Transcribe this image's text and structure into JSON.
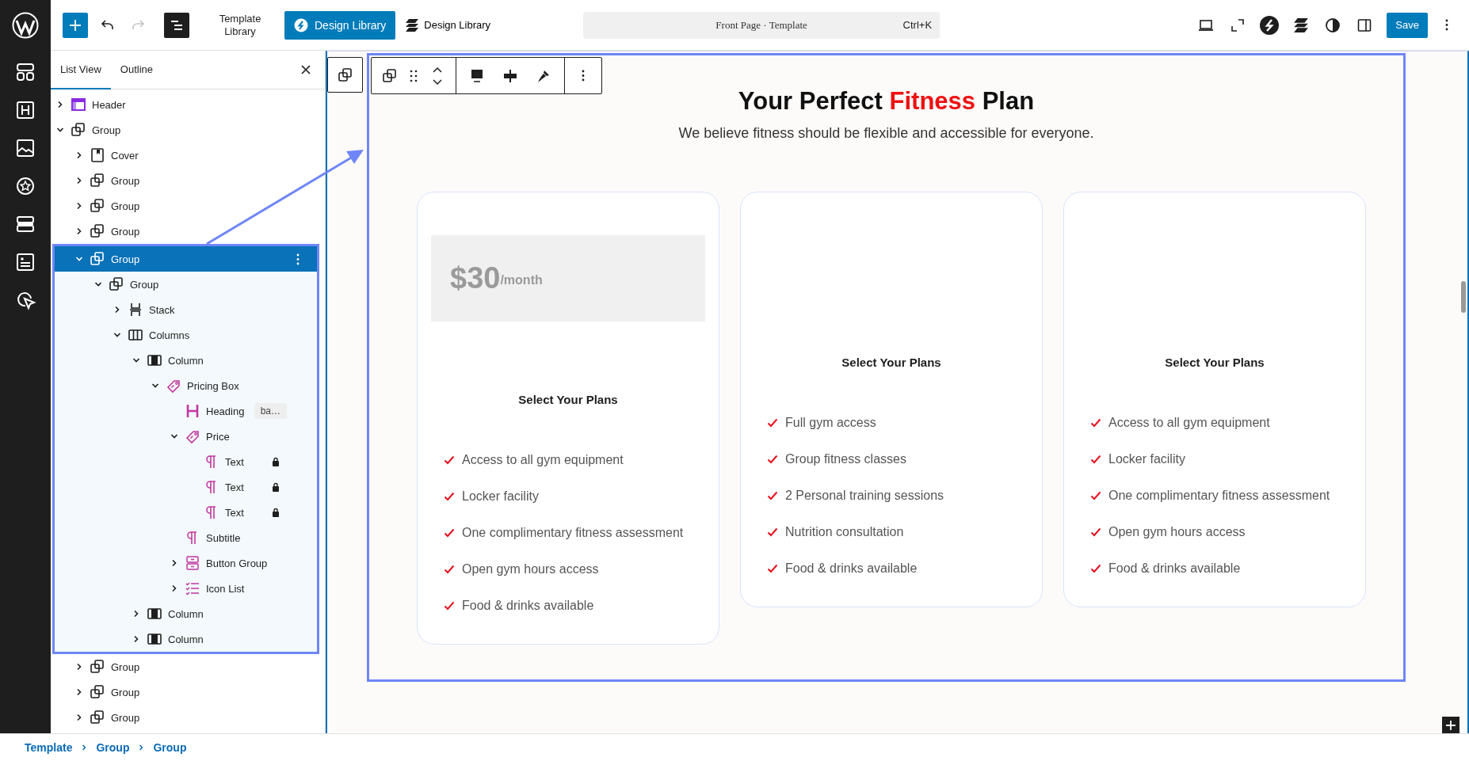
{
  "top_bar": {
    "toolbar": [
      {
        "kind": "add",
        "disabled": false
      },
      {
        "kind": "undo",
        "disabled": false
      },
      {
        "kind": "redo",
        "disabled": true
      },
      {
        "kind": "overview",
        "disabled": false
      }
    ],
    "template_library": "Template Library",
    "design_library_button": "Design Library",
    "design_library_link": "Design Library",
    "command_bar": {
      "title": "Front Page · Template",
      "shortcut": "Ctrl+K"
    },
    "save": "Save"
  },
  "sidebar": {
    "tabs": [
      {
        "label": "List View",
        "selected": true
      },
      {
        "label": "Outline",
        "selected": false
      }
    ],
    "tree": [
      {
        "label": "Header",
        "kind": "header",
        "selected": false,
        "expanded": false
      },
      {
        "label": "Group",
        "kind": "group",
        "selected": false,
        "expanded": true,
        "children": [
          {
            "label": "Cover",
            "kind": "cover",
            "selected": false,
            "expanded": false
          },
          {
            "label": "Group",
            "kind": "group",
            "selected": false,
            "expanded": false
          },
          {
            "label": "Group",
            "kind": "group",
            "selected": false,
            "expanded": false
          },
          {
            "label": "Group",
            "kind": "group",
            "selected": false,
            "expanded": false
          },
          {
            "label": "Group",
            "kind": "group",
            "selected": true,
            "expanded": true,
            "children": [
              {
                "label": "Group",
                "kind": "group",
                "selected": false,
                "expanded": true,
                "children": [
                  {
                    "label": "Stack",
                    "kind": "stack",
                    "selected": false,
                    "expanded": false
                  },
                  {
                    "label": "Columns",
                    "kind": "columns",
                    "selected": false,
                    "expanded": true,
                    "children": [
                      {
                        "label": "Column",
                        "kind": "column",
                        "selected": false,
                        "expanded": true,
                        "children": [
                          {
                            "label": "Pricing Box",
                            "kind": "tag",
                            "selected": false,
                            "expanded": true,
                            "children": [
                              {
                                "label": "Heading",
                                "kind": "heading",
                                "selected": false,
                                "badge": "ba…"
                              },
                              {
                                "label": "Price",
                                "kind": "tag",
                                "selected": false,
                                "expanded": true,
                                "children": [
                                  {
                                    "label": "Text",
                                    "kind": "paragraph",
                                    "selected": false,
                                    "locked": true
                                  },
                                  {
                                    "label": "Text",
                                    "kind": "paragraph",
                                    "selected": false,
                                    "locked": true
                                  },
                                  {
                                    "label": "Text",
                                    "kind": "paragraph",
                                    "selected": false,
                                    "locked": true
                                  }
                                ]
                              },
                              {
                                "label": "Subtitle",
                                "kind": "paragraph",
                                "selected": false
                              },
                              {
                                "label": "Button Group",
                                "kind": "buttons",
                                "selected": false,
                                "expanded": false
                              },
                              {
                                "label": "Icon List",
                                "kind": "iconlist",
                                "selected": false,
                                "expanded": false
                              }
                            ]
                          }
                        ]
                      },
                      {
                        "label": "Column",
                        "kind": "column",
                        "selected": false,
                        "expanded": false
                      },
                      {
                        "label": "Column",
                        "kind": "column",
                        "selected": false,
                        "expanded": false
                      }
                    ]
                  }
                ]
              }
            ]
          },
          {
            "label": "Group",
            "kind": "group",
            "selected": false,
            "expanded": false
          },
          {
            "label": "Group",
            "kind": "group",
            "selected": false,
            "expanded": false
          },
          {
            "label": "Group",
            "kind": "group",
            "selected": false,
            "expanded": false
          }
        ]
      }
    ]
  },
  "canvas": {
    "heading": {
      "before": "Your Perfect",
      "highlight": "Fitness",
      "after": "Plan"
    },
    "subtitle": "We believe fitness should be flexible and accessible for everyone.",
    "cards": [
      {
        "price": {
          "amount": "$30",
          "period": "/month"
        },
        "title": "Select Your Plans",
        "features": [
          "Access to all gym equipment",
          "Locker facility",
          "One complimentary fitness assessment",
          "Open gym hours access",
          "Food & drinks available"
        ]
      },
      {
        "title": "Select Your Plans",
        "features": [
          "Full gym access",
          "Group fitness classes",
          "2 Personal training sessions",
          "Nutrition consultation",
          "Food & drinks available"
        ]
      },
      {
        "title": "Select Your Plans",
        "features": [
          "Access to all gym equipment",
          "Locker facility",
          "One complimentary fitness assessment",
          "Open gym hours access",
          "Food & drinks available"
        ]
      }
    ]
  },
  "breadcrumb": [
    "Template",
    "Group",
    "Group"
  ]
}
